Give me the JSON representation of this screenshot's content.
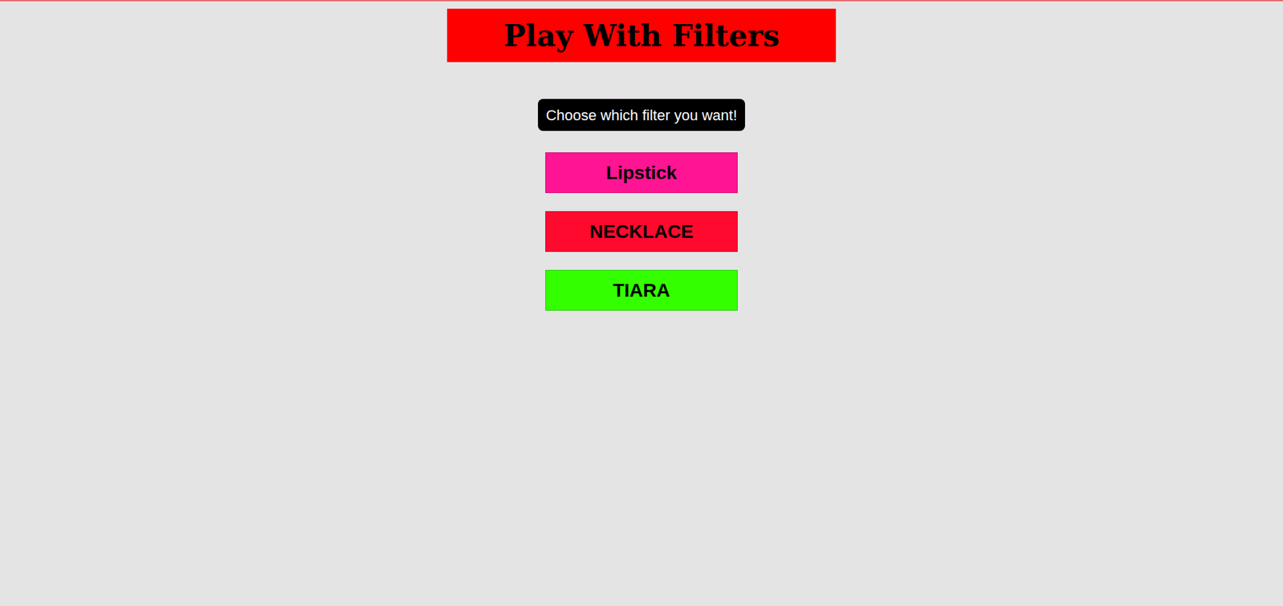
{
  "header": {
    "title": "Play With Filters"
  },
  "prompt": "Choose which filter you want!",
  "filters": [
    {
      "label": "Lipstick",
      "color": "#ff1493"
    },
    {
      "label": "NECKLACE",
      "color": "#ff0a2f"
    },
    {
      "label": "TIARA",
      "color": "#33ff00"
    }
  ]
}
